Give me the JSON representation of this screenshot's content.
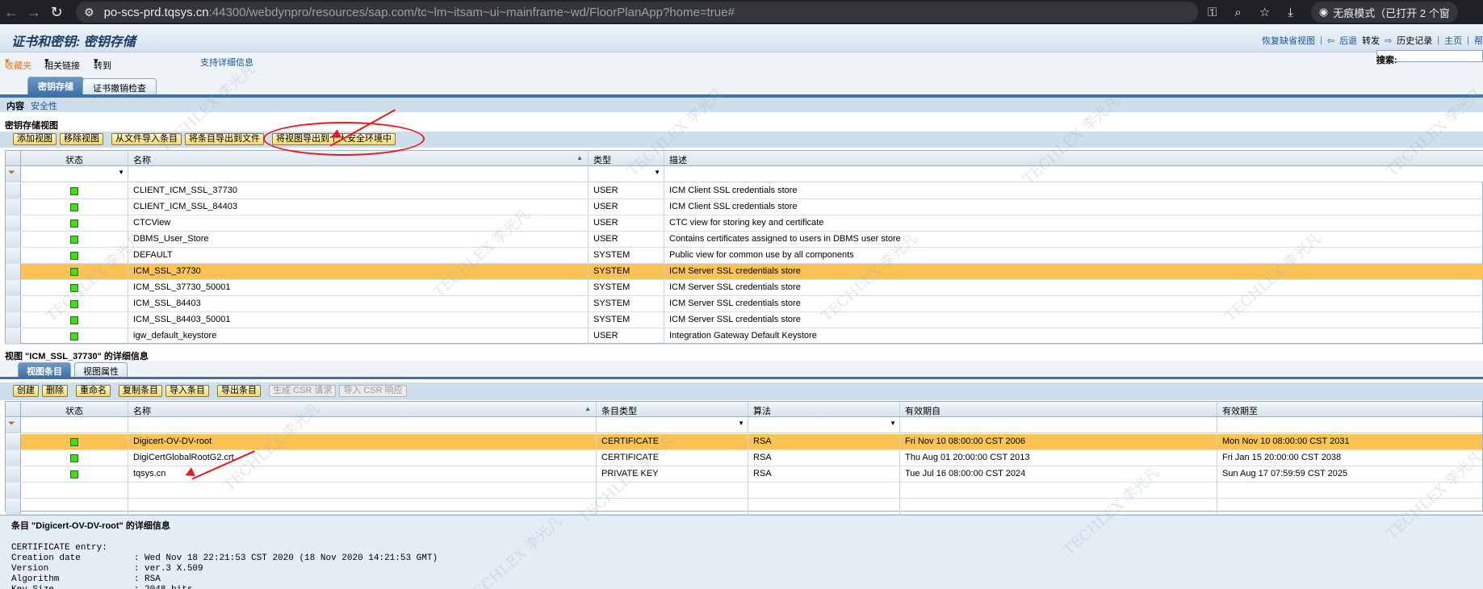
{
  "browser": {
    "url_main": "po-scs-prd.tqsys.cn",
    "url_rest": ":44300/webdynpro/resources/sap.com/tc~lm~itsam~ui~mainframe~wd/FloorPlanApp?home=true#",
    "incognito": "无痕模式（已打开 2 个窗"
  },
  "header": {
    "title": "证书和密钥: 密钥存储",
    "links": [
      "恢复缺省视图",
      "后退",
      "转发",
      "历史记录",
      "主页",
      "帮"
    ]
  },
  "menu": {
    "favorites": "收藏夹",
    "related": "相关链接",
    "goto": "转到",
    "support": "支持详细信息",
    "search_label": "搜索:"
  },
  "tabs": [
    "密钥存储",
    "证书撤销检查"
  ],
  "subnav": {
    "content": "内容",
    "security": "安全性"
  },
  "views_section": {
    "title": "密钥存储视图",
    "buttons": [
      "添加视图",
      "移除视图",
      "从文件导入条目",
      "将条目导出到文件",
      "将视图导出到个人安全环境中"
    ],
    "columns": [
      "状态",
      "名称",
      "类型",
      "描述"
    ],
    "rows": [
      {
        "name": "CLIENT_ICM_SSL_37730",
        "type": "USER",
        "desc": " ICM Client SSL credentials store"
      },
      {
        "name": "CLIENT_ICM_SSL_84403",
        "type": "USER",
        "desc": " ICM Client SSL credentials store"
      },
      {
        "name": "CTCView",
        "type": "USER",
        "desc": "CTC view for storing key and certificate"
      },
      {
        "name": "DBMS_User_Store",
        "type": "USER",
        "desc": "Contains certificates assigned to users in DBMS user store"
      },
      {
        "name": "DEFAULT",
        "type": "SYSTEM",
        "desc": "Public view for common use by all components"
      },
      {
        "name": "ICM_SSL_37730",
        "type": "SYSTEM",
        "desc": " ICM Server SSL credentials store"
      },
      {
        "name": "ICM_SSL_37730_50001",
        "type": "SYSTEM",
        "desc": " ICM Server SSL credentials store"
      },
      {
        "name": "ICM_SSL_84403",
        "type": "SYSTEM",
        "desc": " ICM Server SSL credentials store"
      },
      {
        "name": "ICM_SSL_84403_50001",
        "type": "SYSTEM",
        "desc": " ICM Server SSL credentials store"
      },
      {
        "name": "igw_default_keystore",
        "type": "USER",
        "desc": "Integration Gateway Default Keystore"
      }
    ]
  },
  "view_detail": {
    "title": "视图 \"ICM_SSL_37730\" 的详细信息",
    "tabs": [
      "视图条目",
      "视图属性"
    ],
    "buttons": [
      "创建",
      "删除",
      "重命名",
      "复制条目",
      "导入条目",
      "导出条目",
      "生成 CSR 请求",
      "导入 CSR 响应"
    ],
    "columns": [
      "状态",
      "名称",
      "条目类型",
      "算法",
      "有效期自",
      "有效期至"
    ],
    "rows": [
      {
        "name": "Digicert-OV-DV-root",
        "type": "CERTIFICATE",
        "alg": "RSA",
        "from": "Fri Nov 10 08:00:00 CST 2006",
        "to": "Mon Nov 10 08:00:00 CST 2031"
      },
      {
        "name": "DigiCertGlobalRootG2.crt",
        "type": "CERTIFICATE",
        "alg": "RSA",
        "from": "Thu Aug 01 20:00:00 CST 2013",
        "to": "Fri Jan 15 20:00:00 CST 2038"
      },
      {
        "name": "tqsys.cn",
        "type": "PRIVATE KEY",
        "alg": "RSA",
        "from": "Tue Jul 16 08:00:00 CST 2024",
        "to": "Sun Aug 17 07:59:59 CST 2025"
      }
    ]
  },
  "entry_detail": {
    "title": "条目 \"Digicert-OV-DV-root\" 的详细信息",
    "text": "CERTIFICATE entry:\nCreation date          : Wed Nov 18 22:21:53 CST 2020 (18 Nov 2020 14:21:53 GMT)\nVersion                : ver.3 X.509\nAlgorithm              : RSA\nKey Size               : 2048 bits"
  },
  "watermark": "TECHLEX 李光凡",
  "colors": {
    "highlight": "#fcc354",
    "status_ok": "#3ee015",
    "annotation": "#e8191f"
  }
}
